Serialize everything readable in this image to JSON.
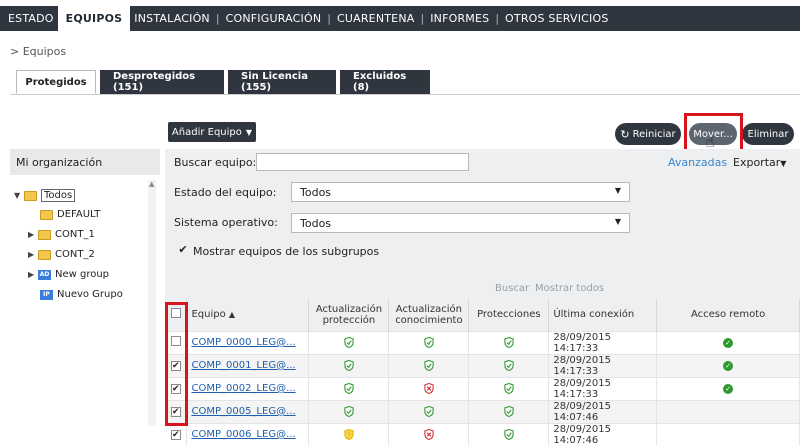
{
  "topnav": {
    "items": [
      "ESTADO",
      "EQUIPOS",
      "INSTALACIÓN",
      "CONFIGURACIÓN",
      "CUARENTENA",
      "INFORMES",
      "OTROS SERVICIOS"
    ],
    "separator": "|"
  },
  "breadcrumb": "> Equipos",
  "tabs": [
    "Protegidos",
    "Desprotegidos (151)",
    "Sin Licencia (155)",
    "Excluidos (8)"
  ],
  "toolbar": {
    "add_label": "Añadir Equipo",
    "restart_label": "Reiniciar",
    "move_label": "Mover...",
    "delete_label": "Eliminar"
  },
  "sidebar": {
    "title": "Mi organización",
    "tree": [
      "Todos",
      "DEFAULT",
      "CONT_1",
      "CONT_2",
      "New group",
      "Nuevo Grupo"
    ]
  },
  "filters": {
    "search_label": "Buscar equipo:",
    "advanced_label": "Avanzadas",
    "export_label": "Exportar",
    "status_label": "Estado del equipo:",
    "status_value": "Todos",
    "os_label": "Sistema operativo:",
    "os_value": "Todos",
    "subgroups_label": "Mostrar equipos de los subgrupos",
    "search_button": "Buscar",
    "show_all_button": "Mostrar todos"
  },
  "table": {
    "headers": [
      "Equipo",
      "Actualización protección",
      "Actualización conocimiento",
      "Protecciones",
      "Última conexión",
      "Acceso remoto"
    ],
    "rows": [
      {
        "name": "COMP_0000_LEG@...",
        "checked": false,
        "upd_prot": "ok",
        "upd_know": "ok",
        "prot": "ok",
        "last": "28/09/2015 14:17:33",
        "remote": true
      },
      {
        "name": "COMP_0001_LEG@...",
        "checked": true,
        "upd_prot": "ok",
        "upd_know": "ok",
        "prot": "ok",
        "last": "28/09/2015 14:17:33",
        "remote": true
      },
      {
        "name": "COMP_0002_LEG@...",
        "checked": true,
        "upd_prot": "ok",
        "upd_know": "error",
        "prot": "ok",
        "last": "28/09/2015 14:17:33",
        "remote": true
      },
      {
        "name": "COMP_0005_LEG@...",
        "checked": true,
        "upd_prot": "ok",
        "upd_know": "ok",
        "prot": "ok",
        "last": "28/09/2015 14:07:46",
        "remote": false
      },
      {
        "name": "COMP_0006_LEG@...",
        "checked": true,
        "upd_prot": "warning",
        "upd_know": "error",
        "prot": "ok",
        "last": "28/09/2015 14:07:46",
        "remote": false
      }
    ]
  },
  "colors": {
    "dark": "#2f363f",
    "ok": "#2e9a2e",
    "error": "#d23232",
    "warning": "#e6b800",
    "highlight": "#d7141b"
  }
}
